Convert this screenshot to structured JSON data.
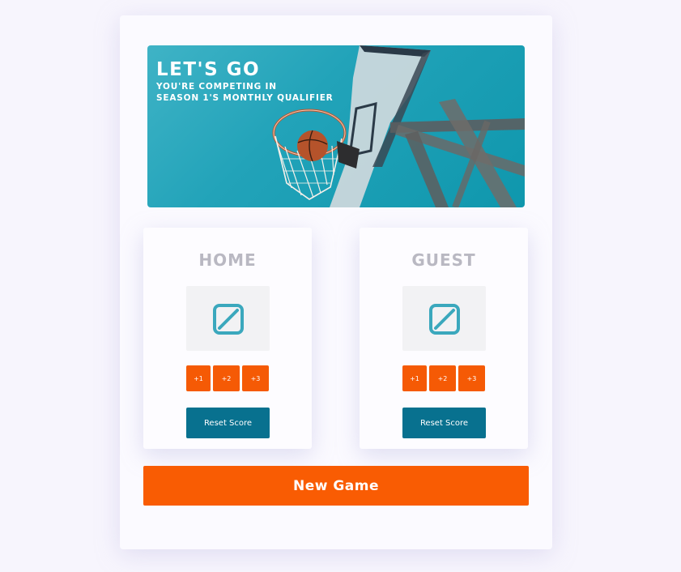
{
  "banner": {
    "title": "LET'S GO",
    "subtitle_line1": "YOU'RE COMPETING IN",
    "subtitle_line2": "SEASON 1'S MONTHLY QUALIFIER",
    "image": "basketball-hoop-photo"
  },
  "home": {
    "name": "HOME",
    "score_icon": "broken-image-icon",
    "buttons": {
      "add1": "+1",
      "add2": "+2",
      "add3": "+3"
    },
    "reset_label": "Reset Score"
  },
  "guest": {
    "name": "GUEST",
    "score_icon": "broken-image-icon",
    "buttons": {
      "add1": "+1",
      "add2": "+2",
      "add3": "+3"
    },
    "reset_label": "Reset Score"
  },
  "new_game_label": "New Game",
  "colors": {
    "page_background": "#f7f5fd",
    "accent_orange": "#f95c03",
    "reset_blue": "#08718f",
    "team_name_gray": "#b9b8c2",
    "icon_teal": "#3ba8bd"
  }
}
